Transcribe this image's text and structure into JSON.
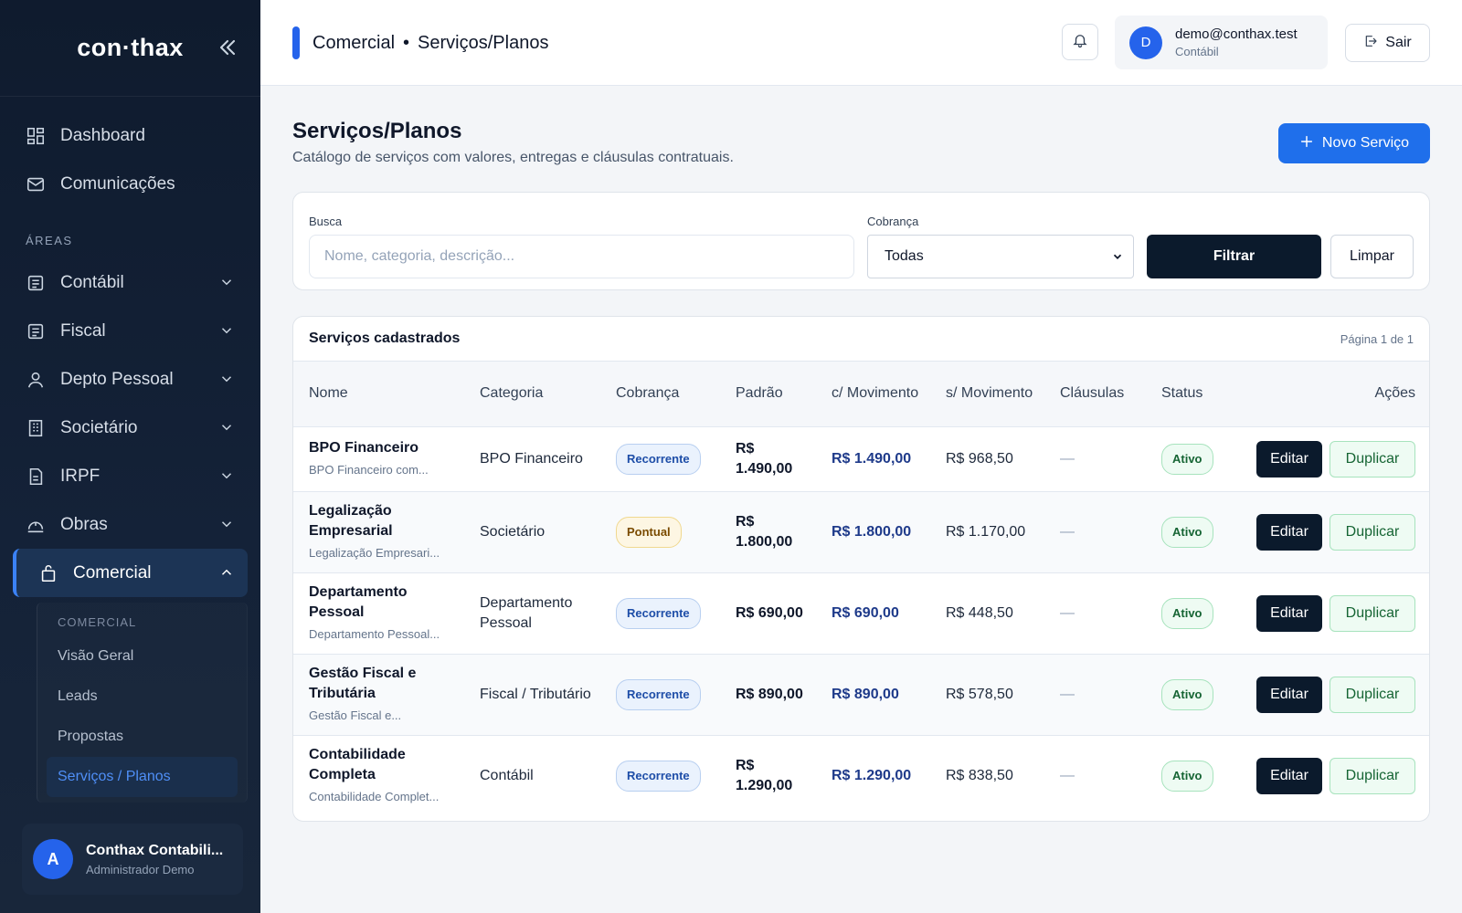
{
  "brand": {
    "logo": "con·thax"
  },
  "sidebar": {
    "top_items": [
      {
        "label": "Dashboard",
        "icon": "dashboard-icon"
      },
      {
        "label": "Comunicações",
        "icon": "mail-icon"
      }
    ],
    "section_label": "ÁREAS",
    "areas": [
      {
        "label": "Contábil",
        "icon": "ledger-icon"
      },
      {
        "label": "Fiscal",
        "icon": "receipt-icon"
      },
      {
        "label": "Depto Pessoal",
        "icon": "user-icon"
      },
      {
        "label": "Societário",
        "icon": "building-icon"
      },
      {
        "label": "IRPF",
        "icon": "document-icon"
      },
      {
        "label": "Obras",
        "icon": "helmet-icon"
      }
    ],
    "active": {
      "label": "Comercial",
      "icon": "bag-icon"
    },
    "sub_label": "COMERCIAL",
    "sub_items": [
      "Visão Geral",
      "Leads",
      "Propostas",
      "Serviços / Planos"
    ],
    "user": {
      "initial": "A",
      "name": "Conthax Contabili...",
      "role": "Administrador Demo"
    }
  },
  "topbar": {
    "breadcrumb_section": "Comercial",
    "breadcrumb_sep": "•",
    "breadcrumb_page": "Serviços/Planos",
    "account_initial": "D",
    "account_email": "demo@conthax.test",
    "account_context": "Contábil",
    "logout_label": "Sair"
  },
  "page": {
    "title": "Serviços/Planos",
    "subtitle": "Catálogo de serviços com valores, entregas e cláusulas contratuais.",
    "new_button": "Novo Serviço"
  },
  "filters": {
    "search_label": "Busca",
    "search_placeholder": "Nome, categoria, descrição...",
    "billing_label": "Cobrança",
    "billing_value": "Todas",
    "filter_button": "Filtrar",
    "clear_button": "Limpar"
  },
  "table": {
    "title": "Serviços cadastrados",
    "pagination": "Página 1 de 1",
    "columns": [
      "Nome",
      "Categoria",
      "Cobrança",
      "Padrão",
      "c/ Movimento",
      "s/ Movimento",
      "Cláusulas",
      "Status",
      "Ações"
    ],
    "edit_label": "Editar",
    "duplicate_label": "Duplicar",
    "rows": [
      {
        "name": "BPO Financeiro",
        "desc": "BPO Financeiro com...",
        "category": "BPO Financeiro",
        "billing": "Recorrente",
        "billing_type": "rec",
        "standard": "R$ 1.490,00",
        "with_mov": "R$ 1.490,00",
        "without_mov": "R$ 968,50",
        "clauses": "—",
        "status": "Ativo"
      },
      {
        "name": "Legalização Empresarial",
        "desc": "Legalização Empresari...",
        "category": "Societário",
        "billing": "Pontual",
        "billing_type": "pon",
        "standard": "R$ 1.800,00",
        "with_mov": "R$ 1.800,00",
        "without_mov": "R$ 1.170,00",
        "clauses": "—",
        "status": "Ativo"
      },
      {
        "name": "Departamento Pessoal",
        "desc": "Departamento Pessoal...",
        "category": "Departamento Pessoal",
        "billing": "Recorrente",
        "billing_type": "rec",
        "standard": "R$ 690,00",
        "with_mov": "R$ 690,00",
        "without_mov": "R$ 448,50",
        "clauses": "—",
        "status": "Ativo"
      },
      {
        "name": "Gestão Fiscal e Tributária",
        "desc": "Gestão Fiscal e...",
        "category": "Fiscal / Tributário",
        "billing": "Recorrente",
        "billing_type": "rec",
        "standard": "R$ 890,00",
        "with_mov": "R$ 890,00",
        "without_mov": "R$ 578,50",
        "clauses": "—",
        "status": "Ativo"
      },
      {
        "name": "Contabilidade Completa",
        "desc": "Contabilidade Complet...",
        "category": "Contábil",
        "billing": "Recorrente",
        "billing_type": "rec",
        "standard": "R$ 1.290,00",
        "with_mov": "R$ 1.290,00",
        "without_mov": "R$ 838,50",
        "clauses": "—",
        "status": "Ativo"
      }
    ]
  },
  "colors": {
    "accent": "#1f6feb",
    "sidebar_bg": "#0f1b2e",
    "dark_button": "#0b1a2c",
    "success": "#166534"
  }
}
